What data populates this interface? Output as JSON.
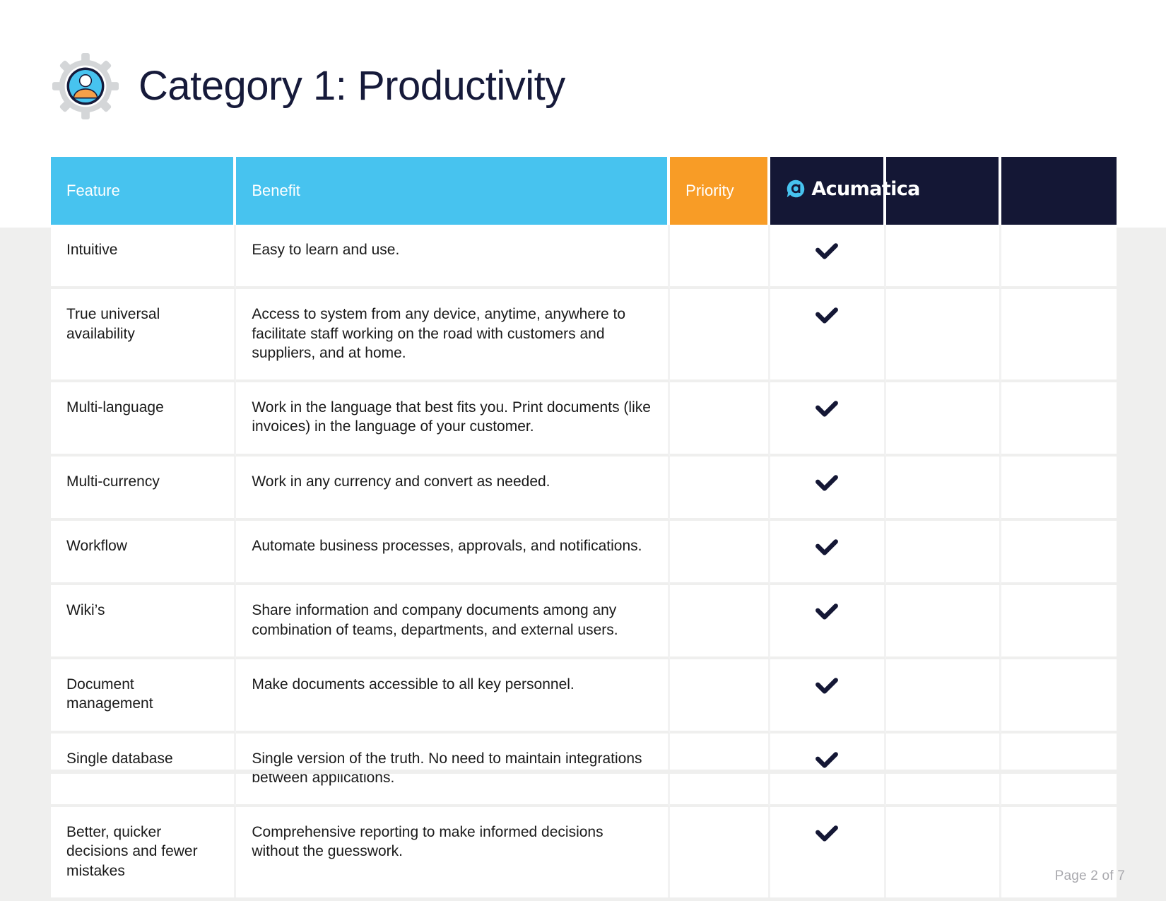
{
  "page": {
    "title": "Category 1: Productivity",
    "icon": "user-gear-icon",
    "footer": "Page 2 of 7",
    "accent_blue": "#47c3ef",
    "accent_orange": "#f89c26",
    "accent_dark": "#141735",
    "background": "#efefee"
  },
  "table": {
    "headers": {
      "feature": "Feature",
      "benefit": "Benefit",
      "priority": "Priority",
      "vendor1": "Acumatica",
      "vendor2": "",
      "vendor3": ""
    },
    "rows": [
      {
        "feature": "Intuitive",
        "benefit": "Easy to learn and use.",
        "priority": "",
        "vendor1": "check",
        "vendor2": "",
        "vendor3": ""
      },
      {
        "feature": "True universal availability",
        "benefit": "Access to system from any device, anytime, anywhere to facilitate staff working on the road with customers and suppliers, and at home.",
        "priority": "",
        "vendor1": "check",
        "vendor2": "",
        "vendor3": ""
      },
      {
        "feature": "Multi-language",
        "benefit": "Work in the language that best fits you. Print documents (like invoices) in the language of your customer.",
        "priority": "",
        "vendor1": "check",
        "vendor2": "",
        "vendor3": ""
      },
      {
        "feature": "Multi-currency",
        "benefit": "Work in any currency and convert as needed.",
        "priority": "",
        "vendor1": "check",
        "vendor2": "",
        "vendor3": ""
      },
      {
        "feature": "Workflow",
        "benefit": "Automate business processes, approvals, and notifications.",
        "priority": "",
        "vendor1": "check",
        "vendor2": "",
        "vendor3": ""
      },
      {
        "feature": "Wiki’s",
        "benefit": "Share information and company documents among any combination of teams, departments, and external users.",
        "priority": "",
        "vendor1": "check",
        "vendor2": "",
        "vendor3": ""
      },
      {
        "feature": "Document management",
        "benefit": "Make documents accessible to all key personnel.",
        "priority": "",
        "vendor1": "check",
        "vendor2": "",
        "vendor3": ""
      },
      {
        "feature": "Single database",
        "benefit": "Single version of the truth. No need to maintain integrations between applications.",
        "priority": "",
        "vendor1": "check",
        "vendor2": "",
        "vendor3": ""
      },
      {
        "feature": "Better, quicker decisions and fewer mistakes",
        "benefit": "Comprehensive reporting to make informed decisions without the guesswork.",
        "priority": "",
        "vendor1": "check",
        "vendor2": "",
        "vendor3": ""
      }
    ]
  }
}
